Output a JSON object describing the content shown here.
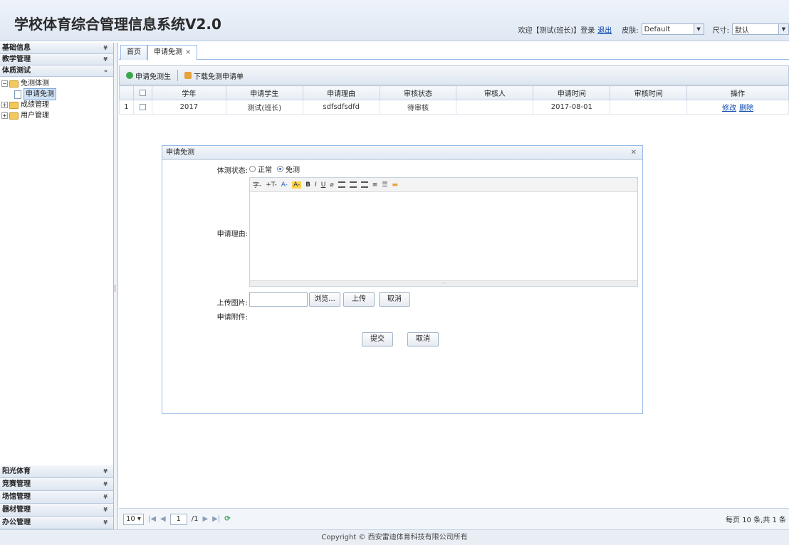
{
  "header": {
    "title": "学校体育综合管理信息系统V2.0",
    "welcome": "欢迎【测试(班长)】登录",
    "logout": "退出",
    "theme_label": "皮肤:",
    "theme_value": "Default",
    "size_label": "尺寸:",
    "size_value": "默认"
  },
  "sidebar": {
    "top_groups": [
      "基础信息",
      "教学管理",
      "体质测试"
    ],
    "tree": {
      "node1": "免测体测",
      "leaf1": "申请免测",
      "node2": "成绩管理",
      "node3": "用户管理"
    },
    "bottom_groups": [
      "阳光体育",
      "竞赛管理",
      "场馆管理",
      "器材管理",
      "办公管理"
    ]
  },
  "tabs": [
    "首页",
    "申请免测"
  ],
  "toolbar": {
    "apply_label": "申请免测生",
    "download_label": "下载免测申请单"
  },
  "grid": {
    "columns": [
      "",
      "学年",
      "申请学生",
      "申请理由",
      "审核状态",
      "审核人",
      "申请时间",
      "审核时间",
      "操作"
    ],
    "rows": [
      {
        "index": "1",
        "year": "2017",
        "student": "测试(班长)",
        "reason": "sdfsdfsdfd",
        "status": "待审核",
        "reviewer": "",
        "apply_time": "2017-08-01",
        "review_time": "",
        "op_edit": "修改",
        "op_delete": "删除"
      }
    ]
  },
  "dialog": {
    "title": "申请免测",
    "status_label": "体测状态:",
    "radio_normal": "正常",
    "radio_exempt": "免测",
    "reason_label": "申请理由:",
    "editor_tools": [
      "字-",
      "+T-",
      "A-",
      "A-",
      "B",
      "I",
      "U"
    ],
    "upload_label": "上传图片:",
    "browse_btn": "浏览...",
    "upload_btn": "上传",
    "cancel_upload_btn": "取消",
    "attachment_label": "申请附件:",
    "submit_btn": "提交",
    "cancel_btn": "取消"
  },
  "pager": {
    "page_size": "10",
    "page_input": "1",
    "page_total": "/1",
    "info": "每页 10 条,共 1 条"
  },
  "footer": {
    "copyright": "Copyright © 西安雷迪体育科技有限公司所有"
  },
  "colors": {
    "accent_border": "#99bbe8",
    "link": "#0645ad",
    "header_bg": "#dfe8f3"
  }
}
